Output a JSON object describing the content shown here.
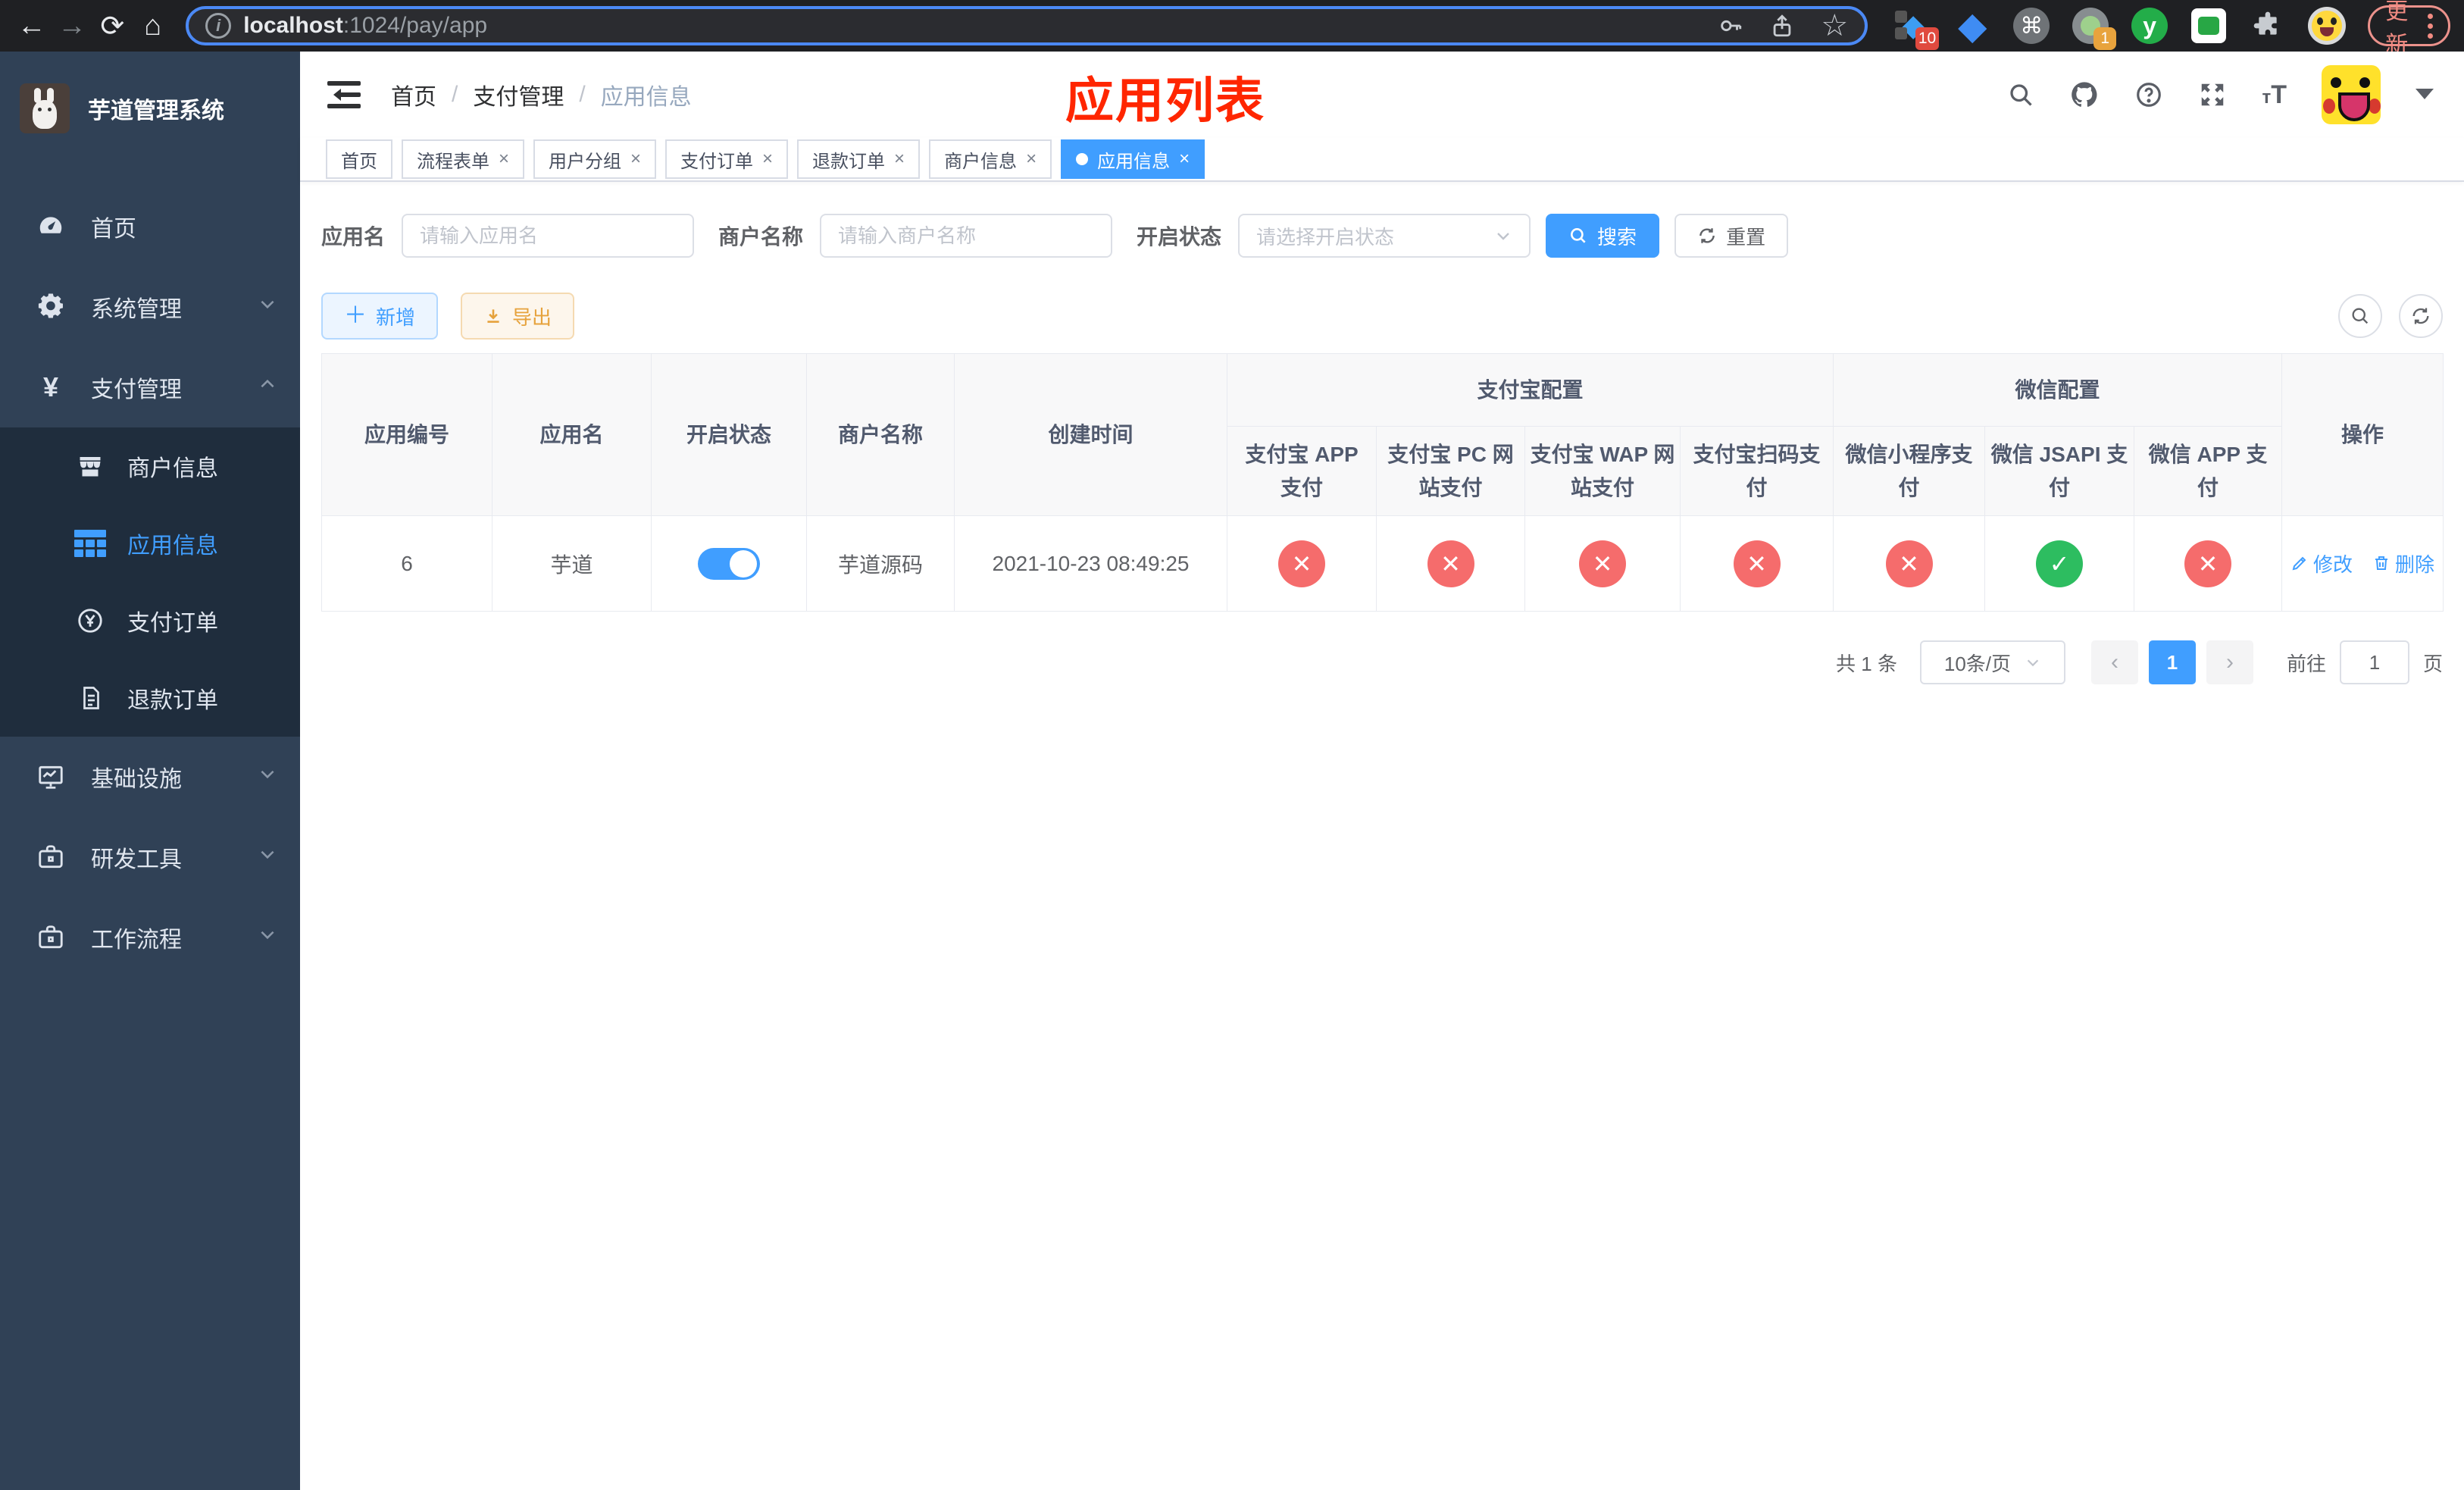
{
  "colors": {
    "accent": "#409eff",
    "danger": "#f56c6c",
    "success": "#2dbd60",
    "warning": "#e6a23c",
    "title_red": "#ff2600"
  },
  "browser": {
    "url_host": "localhost",
    "url_rest": ":1024/pay/app",
    "update_label": "更新",
    "badges": {
      "extensions": "10",
      "proxy": "1"
    },
    "y_extension_letter": "y"
  },
  "sidebar": {
    "title": "芋道管理系统",
    "items": [
      {
        "label": "首页"
      },
      {
        "label": "系统管理"
      },
      {
        "label": "支付管理"
      },
      {
        "label": "商户信息"
      },
      {
        "label": "应用信息"
      },
      {
        "label": "支付订单"
      },
      {
        "label": "退款订单"
      },
      {
        "label": "基础设施"
      },
      {
        "label": "研发工具"
      },
      {
        "label": "工作流程"
      }
    ]
  },
  "header": {
    "breadcrumb": [
      "首页",
      "支付管理",
      "应用信息"
    ],
    "overlay_title": "应用列表"
  },
  "tabs": [
    {
      "label": "首页"
    },
    {
      "label": "流程表单"
    },
    {
      "label": "用户分组"
    },
    {
      "label": "支付订单"
    },
    {
      "label": "退款订单"
    },
    {
      "label": "商户信息"
    },
    {
      "label": "应用信息"
    }
  ],
  "filters": {
    "app_name_label": "应用名",
    "app_name_placeholder": "请输入应用名",
    "merchant_label": "商户名称",
    "merchant_placeholder": "请输入商户名称",
    "status_label": "开启状态",
    "status_placeholder": "请选择开启状态",
    "search_label": "搜索",
    "reset_label": "重置"
  },
  "toolbar": {
    "add_label": "新增",
    "export_label": "导出"
  },
  "table": {
    "columns": {
      "id": "应用编号",
      "name": "应用名",
      "status": "开启状态",
      "merchant": "商户名称",
      "created": "创建时间",
      "ops": "操作"
    },
    "groups": {
      "alipay": "支付宝配置",
      "wechat": "微信配置"
    },
    "channel_columns": [
      "支付宝 APP 支付",
      "支付宝 PC 网站支付",
      "支付宝 WAP 网站支付",
      "支付宝扫码支付",
      "微信小程序支付",
      "微信 JSAPI 支付",
      "微信 APP 支付"
    ],
    "rows": [
      {
        "id": "6",
        "name": "芋道",
        "enabled": true,
        "merchant": "芋道源码",
        "created": "2021-10-23 08:49:25",
        "channels": [
          false,
          false,
          false,
          false,
          false,
          true,
          false
        ],
        "edit_label": "修改",
        "delete_label": "删除"
      }
    ]
  },
  "pagination": {
    "total": "共 1 条",
    "page_size": "10条/页",
    "current_page": "1",
    "goto_label": "前往",
    "goto_value": "1",
    "unit_label": "页"
  }
}
